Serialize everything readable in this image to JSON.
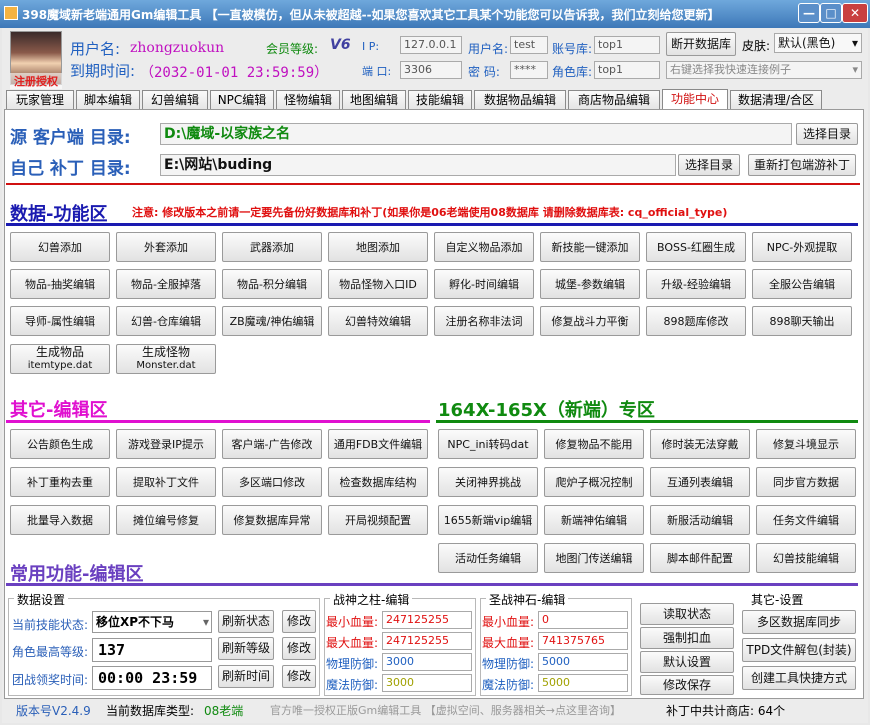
{
  "window": {
    "title": "398魔域新老端通用Gm编辑工具 【一直被模仿，但从未被超越--如果您喜欢其它工具某个功能您可以告诉我，我们立刻给您更新】",
    "min": "—",
    "max": "□",
    "close": "✕"
  },
  "header": {
    "avatar_caption": "注册授权",
    "username_label": "用户名:",
    "username": "zhongzuokun",
    "expiry_label": "到期时间:",
    "expiry": "（2032-01-01 23:59:59）",
    "level_label": "会员等级:",
    "level_badge": "V6",
    "ip_label": "I  P:",
    "ip": "127.0.0.1",
    "port_label": "端 口:",
    "port": "3306",
    "db_user_label": "用户名:",
    "db_user": "test",
    "pwd_label": "密  码:",
    "pwd": "****",
    "account_db_label": "账号库:",
    "account_db": "top1",
    "role_db_label": "角色库:",
    "role_db": "top1",
    "disconnect_btn": "断开数据库",
    "skin_label": "皮肤:",
    "skin_value": "默认(黑色)",
    "quick_conn_placeholder": "右键选择我快速连接例子"
  },
  "tabs": [
    "玩家管理",
    "脚本编辑",
    "幻兽编辑",
    "NPC编辑",
    "怪物编辑",
    "地图编辑",
    "技能编辑",
    "数据物品编辑",
    "商店物品编辑",
    "功能中心",
    "数据清理/合区"
  ],
  "paths": {
    "client_label": "源 客户端 目录:",
    "client_path": "D:\\魔域-以家族之名",
    "client_btn": "选择目录",
    "patch_label": "自己 补丁 目录:",
    "patch_path": "E:\\网站\\buding",
    "patch_btn": "选择目录",
    "repack_btn": "重新打包端游补丁"
  },
  "data_section": {
    "title": "数据-功能区",
    "notice": "注意: 修改版本之前请一定要先备份好数据库和补丁(如果你是06老端使用08数据库 请删除数据库表: cq_official_type)",
    "buttons": [
      [
        "幻兽添加",
        "外套添加",
        "武器添加",
        "地图添加",
        "自定义物品添加",
        "新技能一键添加",
        "BOSS-红圈生成",
        "NPC-外观提取"
      ],
      [
        "物品-抽奖编辑",
        "物品-全服掉落",
        "物品-积分编辑",
        "物品怪物入口ID",
        "孵化-时间编辑",
        "城堡-参数编辑",
        "升级-经验编辑",
        "全服公告编辑"
      ],
      [
        "导师-属性编辑",
        "幻兽-仓库编辑",
        "ZB魔魂/神佑编辑",
        "幻兽特效编辑",
        "注册名称非法词",
        "修复战斗力平衡",
        "898题库修改",
        "898聊天输出"
      ]
    ],
    "gen_item": [
      "生成物品",
      "itemtype.dat"
    ],
    "gen_monster": [
      "生成怪物",
      "Monster.dat"
    ]
  },
  "other_section": {
    "title": "其它-编辑区",
    "buttons": [
      [
        "公告颜色生成",
        "游戏登录IP提示",
        "客户端-广告修改",
        "通用FDB文件编辑"
      ],
      [
        "补丁重构去重",
        "提取补丁文件",
        "多区端口修改",
        "检查数据库结构"
      ],
      [
        "批量导入数据",
        "摊位编号修复",
        "修复数据库异常",
        "开局视频配置"
      ]
    ]
  },
  "new_section": {
    "title": "164X-165X（新端）专区",
    "buttons": [
      [
        "NPC_ini转码dat",
        "修复物品不能用",
        "修时装无法穿戴",
        "修复斗境显示"
      ],
      [
        "关闭神界挑战",
        "爬炉子概况控制",
        "互通列表编辑",
        "同步官方数据"
      ],
      [
        "1655新端vip编辑",
        "新端神佑编辑",
        "新服活动编辑",
        "任务文件编辑"
      ],
      [
        "活动任务编辑",
        "地图门传送编辑",
        "脚本邮件配置",
        "幻兽技能编辑"
      ]
    ]
  },
  "common_section": {
    "title": "常用功能-编辑区",
    "data_settings": {
      "title": "数据设置",
      "skill_state_label": "当前技能状态:",
      "skill_state": "移位XP不下马",
      "max_level_label": "角色最高等级:",
      "max_level": "137",
      "team_time_label": "团战领奖时间:",
      "team_time": "00:00 23:59",
      "refresh_state": "刷新状态",
      "refresh_level": "刷新等级",
      "refresh_time": "刷新时间",
      "modify": "修改"
    },
    "war_pillar": {
      "title": "战神之柱-编辑",
      "min_hp_label": "最小血量:",
      "min_hp": "247125255",
      "max_hp_label": "最大血量:",
      "max_hp": "247125255",
      "phys_def_label": "物理防御:",
      "phys_def": "3000",
      "mag_def_label": "魔法防御:",
      "mag_def": "3000"
    },
    "holy_stone": {
      "title": "圣战神石-编辑",
      "min_hp_label": "最小血量:",
      "min_hp": "0",
      "max_hp_label": "最大血量:",
      "max_hp": "741375765",
      "phys_def_label": "物理防御:",
      "phys_def": "5000",
      "mag_def_label": "魔法防御:",
      "mag_def": "5000"
    },
    "actions": [
      "读取状态",
      "强制扣血",
      "默认设置",
      "修改保存"
    ],
    "other_settings": {
      "title": "其它-设置",
      "buttons": [
        "多区数据库同步",
        "TPD文件解包(封装)",
        "创建工具快捷方式"
      ]
    }
  },
  "status": {
    "version": "版本号V2.4.9",
    "db_type_label": "当前数据库类型:",
    "db_type": "08老端",
    "official": "官方唯一授权正版Gm编辑工具 【虚拟空间、服务器相关→点这里咨询】",
    "shop_count": "补丁中共计商店: 64个"
  },
  "colors": {
    "title_blue": "#2a5fb8",
    "section_red": "#e01010",
    "section_green": "#108a10",
    "bar_blue": "#1a1ab0",
    "bar_pink": "#e010d0",
    "bar_green": "#108a10",
    "bar_purple": "#6a40c0"
  }
}
